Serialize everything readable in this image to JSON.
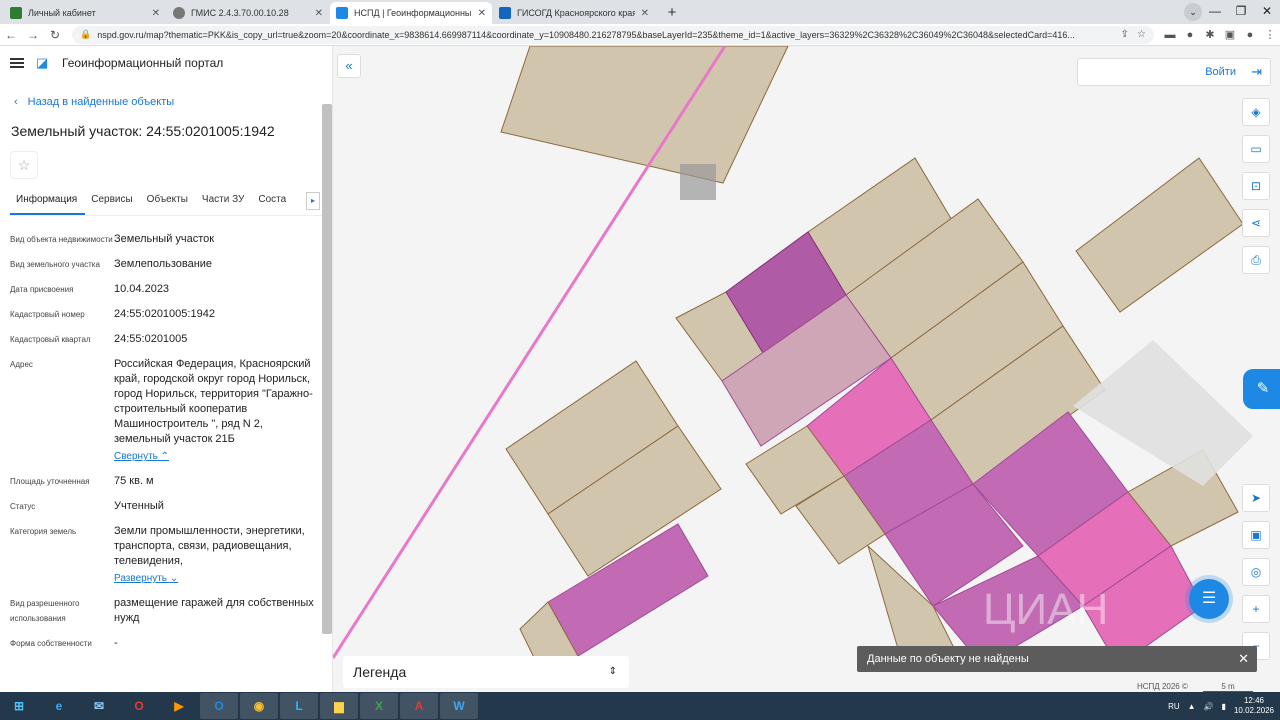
{
  "browser": {
    "tabs": [
      {
        "title": "Личный кабинет",
        "color": "#2e7d32",
        "active": false
      },
      {
        "title": "ГМИС 2.4.3.70.00.10.28",
        "color": "#555555",
        "active": false
      },
      {
        "title": "НСПД | Геоинформационный п",
        "color": "#1e88e5",
        "active": true
      },
      {
        "title": "ГИСОГД Красноярского края",
        "color": "#1565c0",
        "active": false
      }
    ],
    "url": "nspd.gov.ru/map?thematic=PKK&is_copy_url=true&zoom=20&coordinate_x=9838614.669987114&coordinate_y=10908480.216278795&baseLayerId=235&theme_id=1&active_layers=36329%2C36328%2C36049%2C36048&selectedCard=416..."
  },
  "panel": {
    "portal_name": "Геоинформационный портал",
    "back_link": "Назад в найденные объекты",
    "title": "Земельный участок: 24:55:0201005:1942",
    "tabs": [
      "Информация",
      "Сервисы",
      "Объекты",
      "Части ЗУ",
      "Соста"
    ],
    "rows": [
      {
        "key": "Вид объекта недвижимости",
        "value": "Земельный участок"
      },
      {
        "key": "Вид земельного участка",
        "value": "Землепользование"
      },
      {
        "key": "Дата присвоения",
        "value": "10.04.2023"
      },
      {
        "key": "Кадастровый номер",
        "value": "24:55:0201005:1942"
      },
      {
        "key": "Кадастровый квартал",
        "value": "24:55:0201005"
      },
      {
        "key": "Адрес",
        "value": "Российская Федерация, Красноярский край, городской округ город Норильск, город Норильск, территория \"Гаражно-строительный кооператив Машиностроитель \", ряд N 2, земельный участок 21Б",
        "link": "Свернуть"
      },
      {
        "key": "Площадь уточненная",
        "value": "75 кв. м"
      },
      {
        "key": "Статус",
        "value": "Учтенный"
      },
      {
        "key": "Категория земель",
        "value": "Земли промышленности, энергетики, транспорта, связи, радиовещания, телевидения,",
        "link": "Развернуть"
      },
      {
        "key": "Вид разрешенного использования",
        "value": "размещение гаражей для собственных нужд"
      },
      {
        "key": "Форма собственности",
        "value": "-"
      }
    ]
  },
  "map": {
    "login_label": "Войти",
    "legend_label": "Легенда",
    "toast": "Данные по объекту не найдены",
    "copyright": "НСПД 2026 ©",
    "scale": "5 m",
    "watermark": "ЦИАН",
    "colors": {
      "parcel": "#d2c5ae",
      "parcel_stroke": "#8b6a3e",
      "selected": "#e66fba",
      "dark": "#b05ba5",
      "line": "#e878c8"
    }
  },
  "taskbar": {
    "apps": [
      "start",
      "ie",
      "thunderbird",
      "opera",
      "media",
      "outlook",
      "chrome",
      "lync",
      "explorer",
      "excel",
      "acrobat",
      "word"
    ],
    "lang": "RU",
    "time": "12:46",
    "date": "10.02.2026"
  }
}
